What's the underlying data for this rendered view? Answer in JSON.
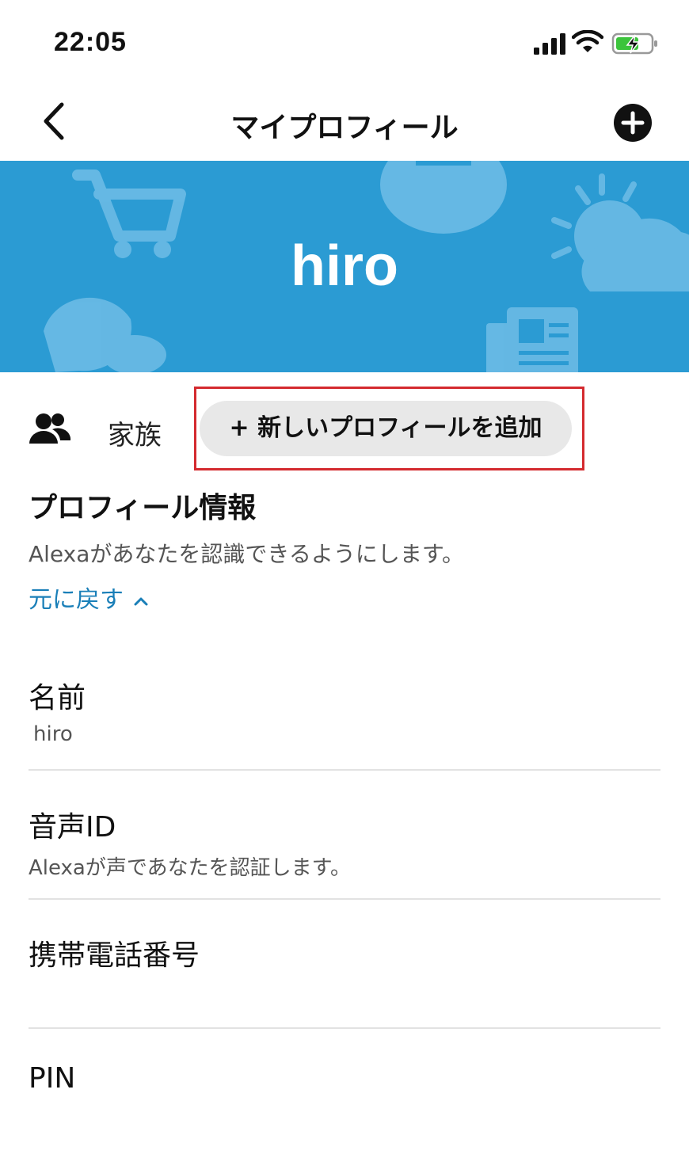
{
  "status": {
    "time": "22:05"
  },
  "nav": {
    "title": "マイプロフィール"
  },
  "banner": {
    "name": "hiro",
    "color": "#2b9bd3"
  },
  "family": {
    "label": "家族",
    "add_button": "+ 新しいプロフィールを追加"
  },
  "profile_info": {
    "title": "プロフィール情報",
    "description": "Alexaがあなたを認識できるようにします。",
    "revert_link": "元に戻す"
  },
  "rows": [
    {
      "title": "名前",
      "subtitle": "hiro"
    },
    {
      "title": "音声ID",
      "subtitle": "Alexaが声であなたを認証します。"
    },
    {
      "title": "携帯電話番号",
      "subtitle": ""
    },
    {
      "title": "PIN",
      "subtitle": ""
    }
  ],
  "colors": {
    "accent": "#1a7fb8",
    "highlight": "#d42a2f",
    "button_bg": "#e8e8e8"
  },
  "icons": [
    "signal-icon",
    "wifi-icon",
    "battery-charging-icon",
    "back-chevron-icon",
    "add-circle-icon",
    "people-icon",
    "chevron-up-icon"
  ]
}
